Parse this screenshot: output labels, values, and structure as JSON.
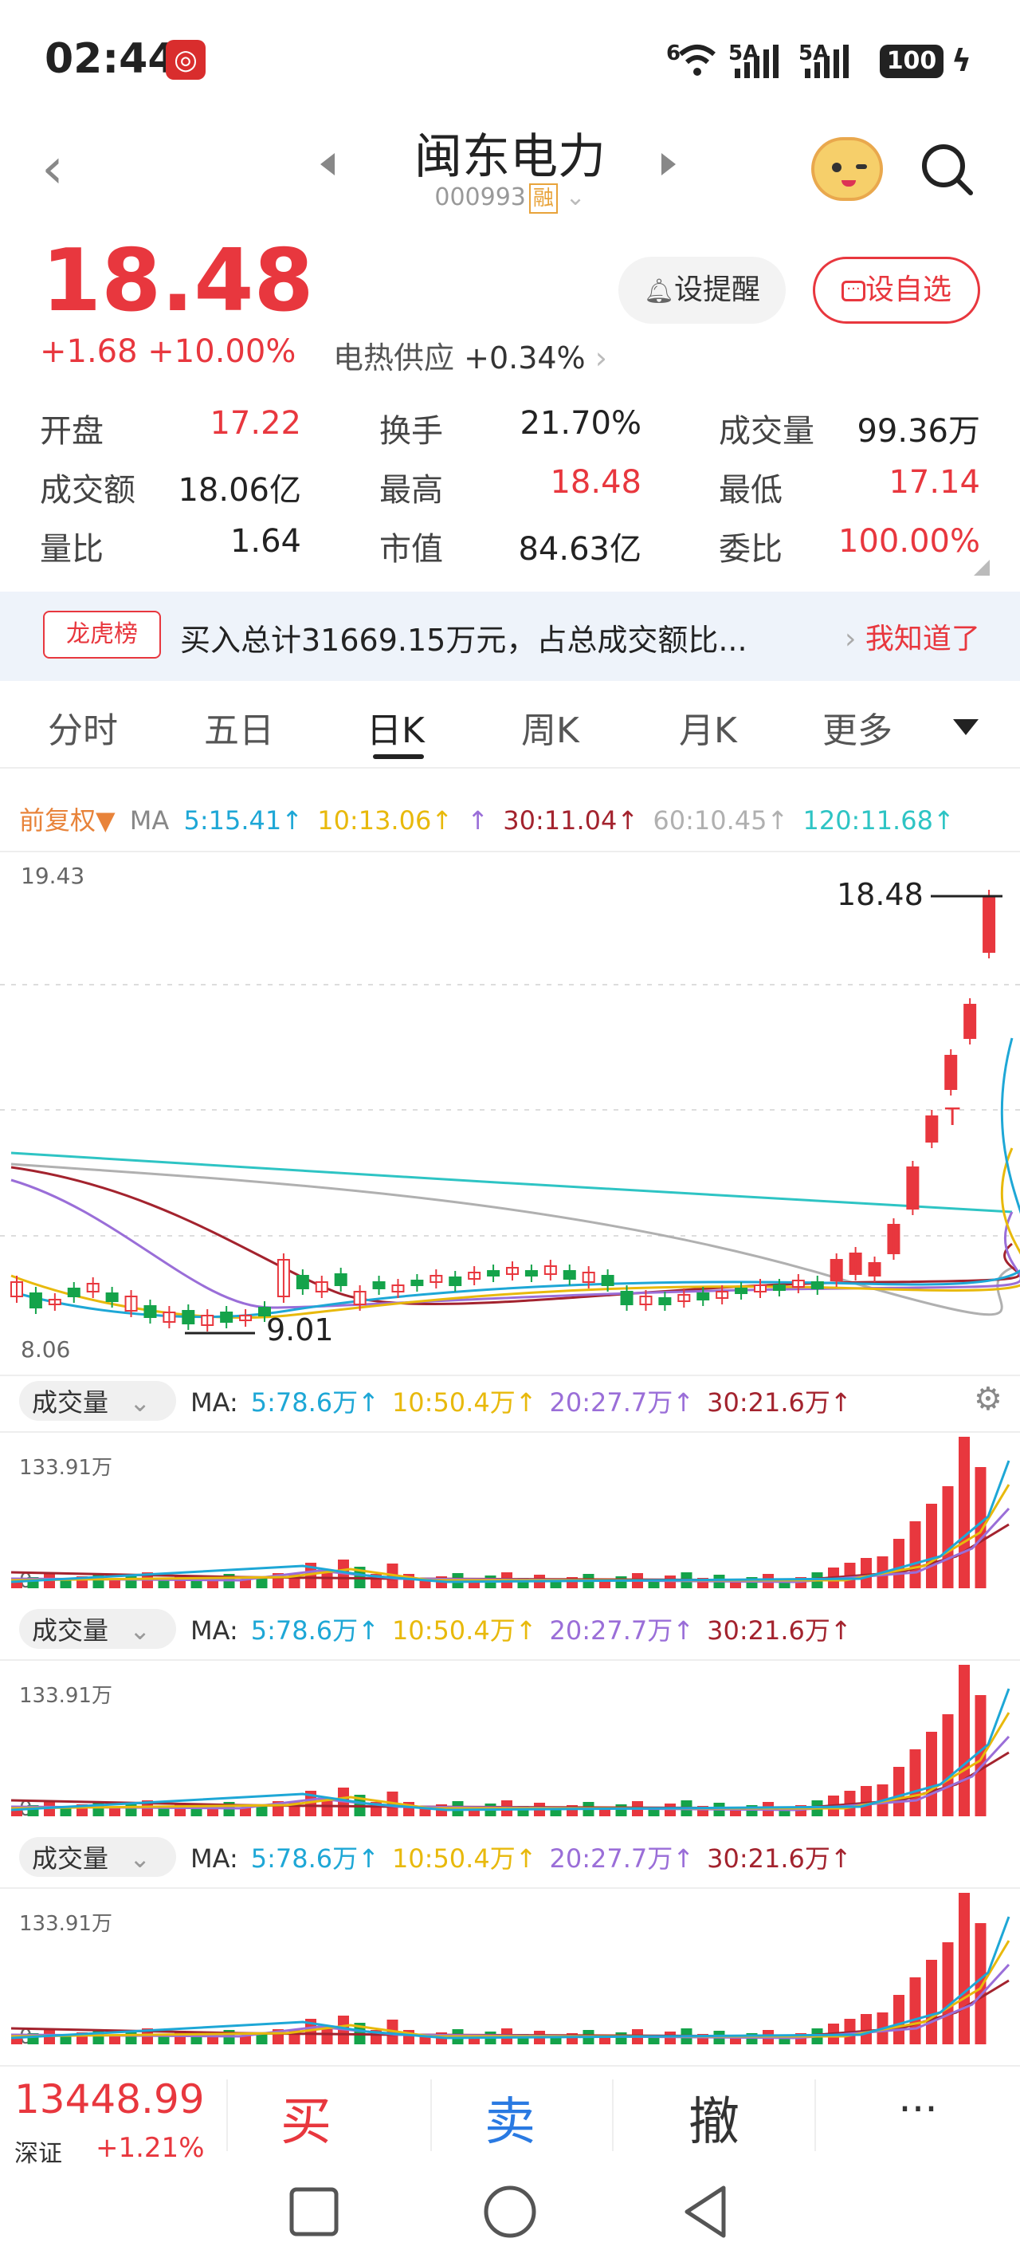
{
  "status_bar": {
    "time": "02:44",
    "net1": "6",
    "net2": "5A",
    "net3": "5A",
    "battery": "100"
  },
  "header": {
    "title": "闽东电力",
    "code": "000993",
    "margin_badge": "融"
  },
  "quote": {
    "price": "18.48",
    "change": "+1.68  +10.00%",
    "sector_name": "电热供应",
    "sector_change": "+0.34%",
    "alert_button": "设提醒",
    "watch_button": "设自选"
  },
  "stats": [
    {
      "label": "开盘",
      "value": "17.22",
      "color": "red"
    },
    {
      "label": "换手",
      "value": "21.70%",
      "color": "dark"
    },
    {
      "label": "成交量",
      "value": "99.36万",
      "color": "dark"
    },
    {
      "label": "成交额",
      "value": "18.06亿",
      "color": "dark"
    },
    {
      "label": "最高",
      "value": "18.48",
      "color": "red"
    },
    {
      "label": "最低",
      "value": "17.14",
      "color": "red"
    },
    {
      "label": "量比",
      "value": "1.64",
      "color": "dark"
    },
    {
      "label": "市值",
      "value": "84.63亿",
      "color": "dark"
    },
    {
      "label": "委比",
      "value": "100.00%",
      "color": "red"
    }
  ],
  "longhubang": {
    "tag": "龙虎榜",
    "text": "买入总计31669.15万元，占总成交额比...",
    "action": "我知道了"
  },
  "tabs": [
    "分时",
    "五日",
    "日K",
    "周K",
    "月K",
    "更多"
  ],
  "ma": {
    "adjust": "前复权▼",
    "label": "MA",
    "ma5": "5:15.41↑",
    "ma10": "10:13.06↑",
    "ma20": "↑",
    "ma30": "30:11.04↑",
    "ma60": "60:10.45↑",
    "ma120": "120:11.68↑"
  },
  "kline": {
    "y_top": "19.43",
    "y_bottom": "8.06",
    "last_label": "18.48",
    "low_label": "9.01",
    "marker": "T"
  },
  "volume": {
    "pill": "成交量",
    "label": "MA:",
    "ma5": "5:78.6万↑",
    "ma10": "10:50.4万↑",
    "ma20": "20:27.7万↑",
    "ma30": "30:21.6万↑",
    "y_top": "133.91万",
    "y_zero": "0"
  },
  "bottom_bar": {
    "index_value": "13448.99",
    "index_name": "深证",
    "index_change": "+1.21%",
    "buy": "买",
    "sell": "卖",
    "cancel": "撤",
    "more": "···"
  },
  "colors": {
    "up": "#e8373e",
    "down": "#14a34a",
    "ma5": "#1ea7d6",
    "ma10": "#e8b90c",
    "ma20": "#9a6ed8",
    "ma30": "#a3232e",
    "ma60": "#b0b0b0",
    "ma120": "#2ec4c4"
  }
}
